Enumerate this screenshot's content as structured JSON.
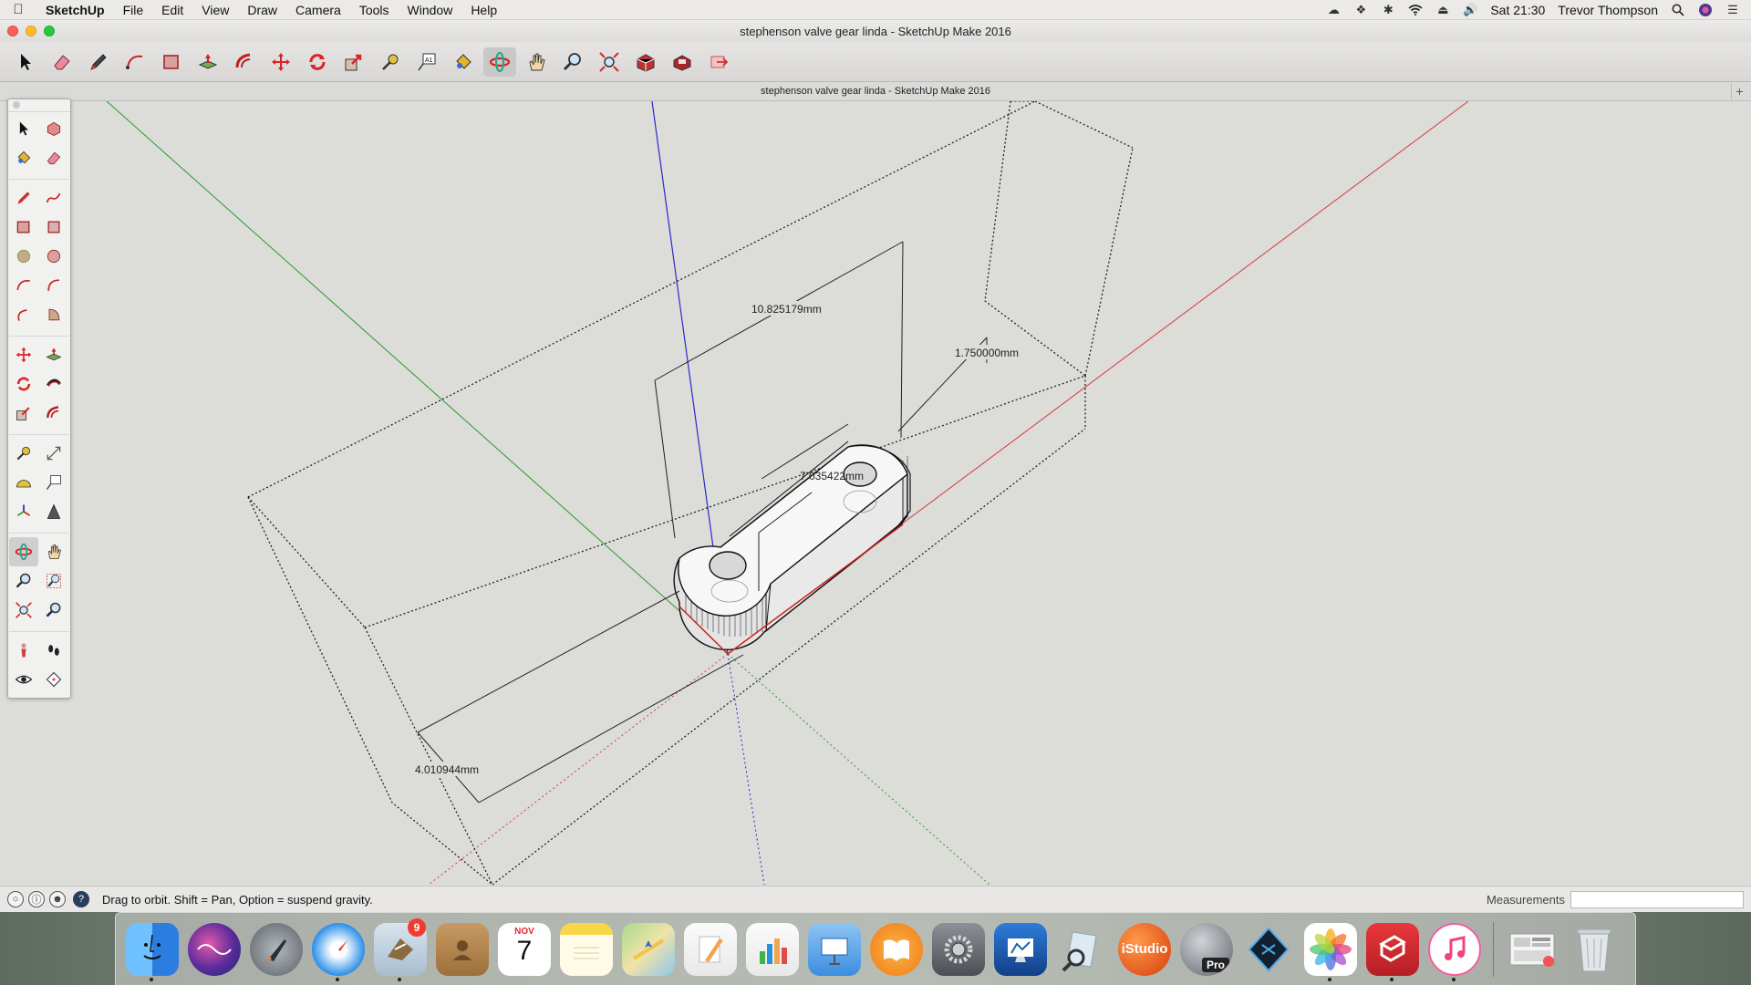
{
  "menubar": {
    "app_name": "SketchUp",
    "items": [
      "File",
      "Edit",
      "View",
      "Draw",
      "Camera",
      "Tools",
      "Window",
      "Help"
    ],
    "clock": "Sat 21:30",
    "user": "Trevor Thompson",
    "status_icons": [
      "creative-cloud-icon",
      "dropbox-icon",
      "bluetooth-icon",
      "wifi-icon",
      "eject-icon",
      "volume-icon"
    ]
  },
  "window": {
    "title": "stephenson valve gear linda - SketchUp Make 2016",
    "doc_tab": "stephenson valve gear linda - SketchUp Make 2016",
    "add_tab": "+"
  },
  "toolbar": {
    "tools": [
      "select",
      "eraser",
      "line",
      "arc",
      "rectangle",
      "push-pull",
      "offset",
      "move",
      "rotate",
      "scale",
      "tape-measure",
      "text",
      "paint-bucket",
      "orbit",
      "pan",
      "zoom",
      "zoom-extents",
      "warehouse",
      "extension-warehouse",
      "send-to-layout"
    ],
    "active": "orbit"
  },
  "scene": {
    "dimensions": [
      "10.825179mm",
      "1.750000mm",
      "7.035422mm",
      "4.010944mm"
    ],
    "axis_colors": {
      "red": "#d63a3a",
      "green": "#2f9a2f",
      "blue": "#2a2acc"
    }
  },
  "palette": {
    "tools": [
      "select",
      "component",
      "paint",
      "eraser",
      "line",
      "freehand",
      "rectangle",
      "rotated-rectangle",
      "circle",
      "polygon",
      "arc",
      "2pt-arc",
      "3pt-arc",
      "pie",
      "move",
      "push-pull",
      "rotate",
      "follow-me",
      "scale",
      "offset",
      "tape",
      "dimension",
      "protractor",
      "text",
      "axes",
      "3d-text",
      "orbit",
      "pan",
      "zoom",
      "zoom-window",
      "zoom-extents",
      "previous",
      "position-camera",
      "walk",
      "look-around",
      "section-plane"
    ],
    "active": "orbit"
  },
  "status": {
    "hint": "Drag to orbit. Shift = Pan, Option = suspend gravity.",
    "measurements_label": "Measurements",
    "measurements_value": ""
  },
  "dock": {
    "apps": [
      {
        "name": "Finder",
        "icon": "finder-icon",
        "color": "#3a8ee6",
        "running": true
      },
      {
        "name": "Siri",
        "icon": "siri-icon",
        "color": "#5b2a9a",
        "running": false
      },
      {
        "name": "Launchpad",
        "icon": "launchpad-icon",
        "color": "#8c8f96",
        "running": false
      },
      {
        "name": "Safari",
        "icon": "safari-icon",
        "color": "#2b8fe8",
        "running": true
      },
      {
        "name": "Mail",
        "icon": "mail-icon",
        "color": "#c7d6e6",
        "running": true,
        "badge": "9"
      },
      {
        "name": "Contacts",
        "icon": "contacts-icon",
        "color": "#b48a55",
        "running": false
      },
      {
        "name": "Calendar",
        "icon": "calendar-icon",
        "color": "#ffffff",
        "running": false,
        "month": "NOV",
        "day": "7"
      },
      {
        "name": "Notes",
        "icon": "notes-icon",
        "color": "#f9e27a",
        "running": false
      },
      {
        "name": "Maps",
        "icon": "maps-icon",
        "color": "#7cc36b",
        "running": false
      },
      {
        "name": "Pages",
        "icon": "pages-icon",
        "color": "#f2a54a",
        "running": false
      },
      {
        "name": "Numbers",
        "icon": "numbers-icon",
        "color": "#3fb44a",
        "running": false
      },
      {
        "name": "Keynote",
        "icon": "keynote-icon",
        "color": "#3c8de0",
        "running": false
      },
      {
        "name": "iBooks",
        "icon": "ibooks-icon",
        "color": "#f28a1e",
        "running": false
      },
      {
        "name": "System Preferences",
        "icon": "gear-icon",
        "color": "#6d6f74",
        "running": false
      },
      {
        "name": "Remote Desktop",
        "icon": "remote-desktop-icon",
        "color": "#1d5fb3",
        "running": false
      },
      {
        "name": "Preview",
        "icon": "preview-icon",
        "color": "#8ab6d9",
        "running": false
      },
      {
        "name": "iStudio",
        "icon": "istudio-icon",
        "color": "#e85a1c",
        "running": false,
        "label": "iStudio"
      },
      {
        "name": "Google Earth Pro",
        "icon": "google-earth-icon",
        "color": "#555a60",
        "running": false,
        "label": "Pro"
      },
      {
        "name": "Sketch Toolkit",
        "icon": "diamond-icon",
        "color": "#1d2a3a",
        "running": false
      },
      {
        "name": "Photos",
        "icon": "photos-icon",
        "color": "#ffffff",
        "running": true
      },
      {
        "name": "SketchUp",
        "icon": "sketchup-icon",
        "color": "#d4282d",
        "running": true
      },
      {
        "name": "iTunes",
        "icon": "itunes-icon",
        "color": "#f45ea0",
        "running": true
      }
    ],
    "trailing": [
      {
        "name": "Documents Stack",
        "icon": "stack-icon",
        "color": "#e6e6e6"
      },
      {
        "name": "Trash",
        "icon": "trash-icon",
        "color": "#d8d8d8"
      }
    ]
  }
}
